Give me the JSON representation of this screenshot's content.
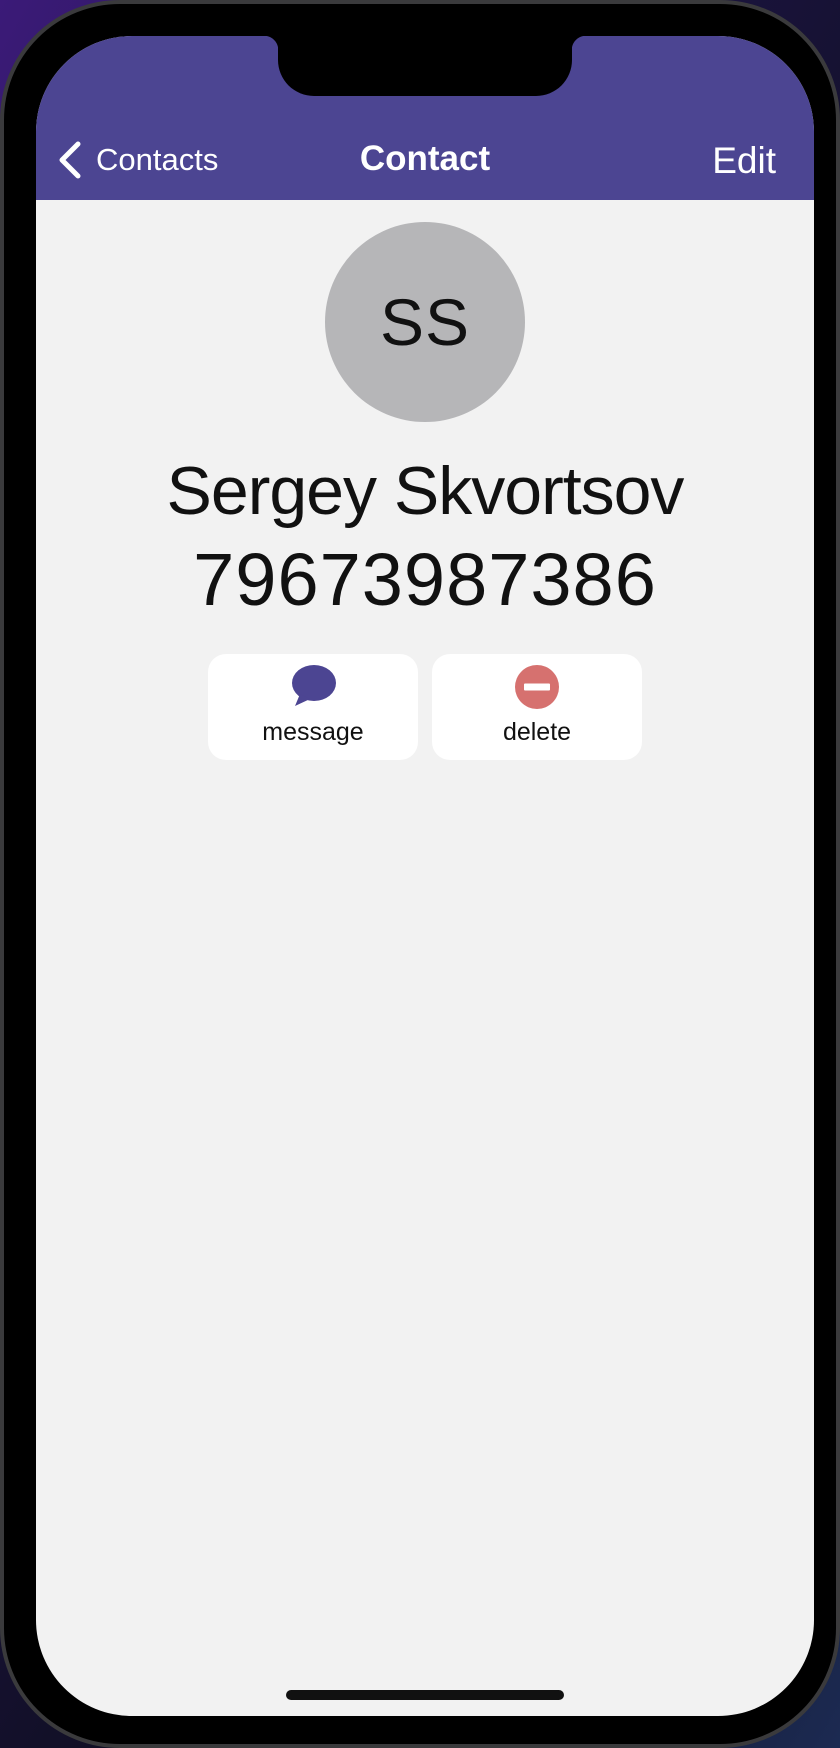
{
  "nav": {
    "back_label": "Contacts",
    "title": "Contact",
    "edit_label": "Edit"
  },
  "contact": {
    "initials": "SS",
    "name": "Sergey Skvortsov",
    "phone": "79673987386"
  },
  "actions": {
    "message_label": "message",
    "delete_label": "delete"
  },
  "icons": {
    "back": "chevron-left-icon",
    "message": "speech-bubble-icon",
    "delete": "minus-circle-icon"
  },
  "colors": {
    "nav_background": "#4c4592",
    "screen_background": "#f2f2f2",
    "avatar_background": "#b6b6b8",
    "message_icon": "#4c4592",
    "delete_icon": "#d6716f"
  }
}
